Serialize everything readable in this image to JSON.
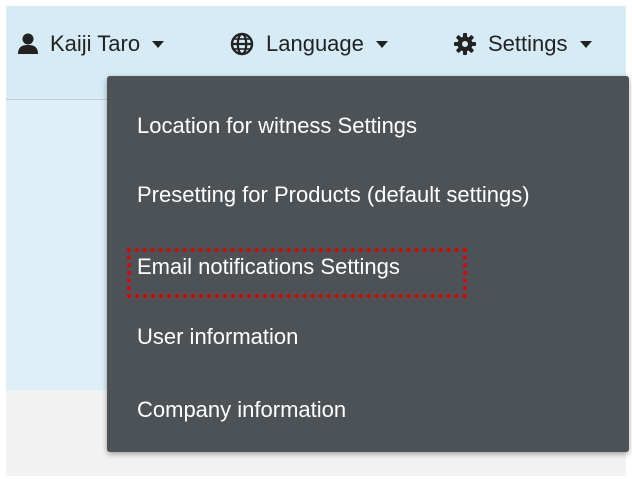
{
  "navbar": {
    "user": {
      "name": "Kaiji Taro",
      "icon": "user-icon"
    },
    "language": {
      "label": "Language",
      "icon": "globe-icon"
    },
    "settings": {
      "label": "Settings",
      "icon": "gear-icon"
    }
  },
  "settings_menu": {
    "items": [
      {
        "label": "Location for witness Settings"
      },
      {
        "label": "Presetting for Products (default settings)"
      },
      {
        "label": "Email notifications Settings"
      },
      {
        "label": "User information"
      },
      {
        "label": "Company information"
      }
    ],
    "highlighted_item": "Email notifications Settings",
    "highlight_color": "#e00000",
    "background_color": "#4d5256"
  }
}
